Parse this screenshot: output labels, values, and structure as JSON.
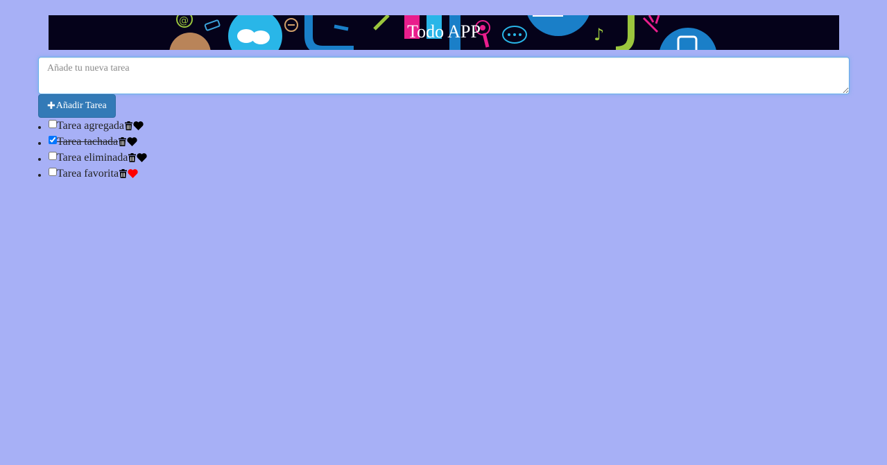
{
  "app": {
    "title": "Todo APP"
  },
  "form": {
    "placeholder": "Añade tu nueva tarea",
    "add_button_label": "Añadir Tarea",
    "add_button_icon": "plus-icon"
  },
  "tasks": [
    {
      "label": "Tarea agregada",
      "checked": false,
      "favorite": false
    },
    {
      "label": "Tarea tachada",
      "checked": true,
      "favorite": false
    },
    {
      "label": "Tarea eliminada",
      "checked": false,
      "favorite": false
    },
    {
      "label": "Tarea favorita",
      "checked": false,
      "favorite": true
    }
  ],
  "colors": {
    "background": "#a7b0f6",
    "banner_background": "#05021a",
    "button": "#337ab7",
    "favorite_heart": "#ff0000",
    "default_heart": "#000000"
  },
  "icons": {
    "delete": "trash-icon",
    "favorite": "heart-icon"
  }
}
